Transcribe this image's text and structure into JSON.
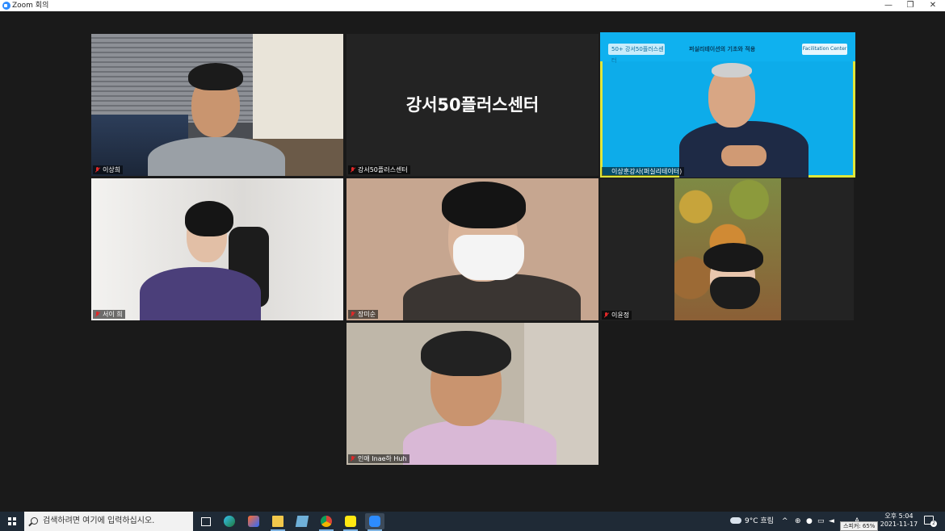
{
  "window": {
    "title": "Zoom 회의",
    "controls": {
      "minimize": "—",
      "restore": "❐",
      "close": "✕"
    }
  },
  "participants": [
    {
      "name": "이상희",
      "muted": true
    },
    {
      "name": "강서50플러스센터",
      "muted": true,
      "display_text": "강서50플러스센터"
    },
    {
      "name": "이상훈강사(퍼실리테이터)",
      "muted": false,
      "active_speaker": true
    },
    {
      "name": "서이 희",
      "muted": true
    },
    {
      "name": "장미순",
      "muted": true
    },
    {
      "name": "이윤정",
      "muted": true
    },
    {
      "name": "인애 Inae하 Huh",
      "muted": true
    }
  ],
  "slide_banner": {
    "left_logo": "50+ 강서50플러스센터",
    "title": "퍼실리테이션의 기초와 적용",
    "right_logo": "Facilitation Center"
  },
  "taskbar": {
    "search_placeholder": "검색하려면 여기에 입력하십시오.",
    "apps": [
      "task-view",
      "edge",
      "app-orange",
      "file-explorer",
      "notepad",
      "chrome",
      "kakaotalk",
      "zoom"
    ],
    "weather": "9°C 흐림",
    "clock_time": "오후 5:04",
    "clock_date": "2021-11-17",
    "speaker_tooltip": "스피커: 65%",
    "notification_count": "2"
  },
  "colors": {
    "active_border": "#dfe63a",
    "muted_icon": "#e02828",
    "zoom_blue": "#2d8cff"
  }
}
